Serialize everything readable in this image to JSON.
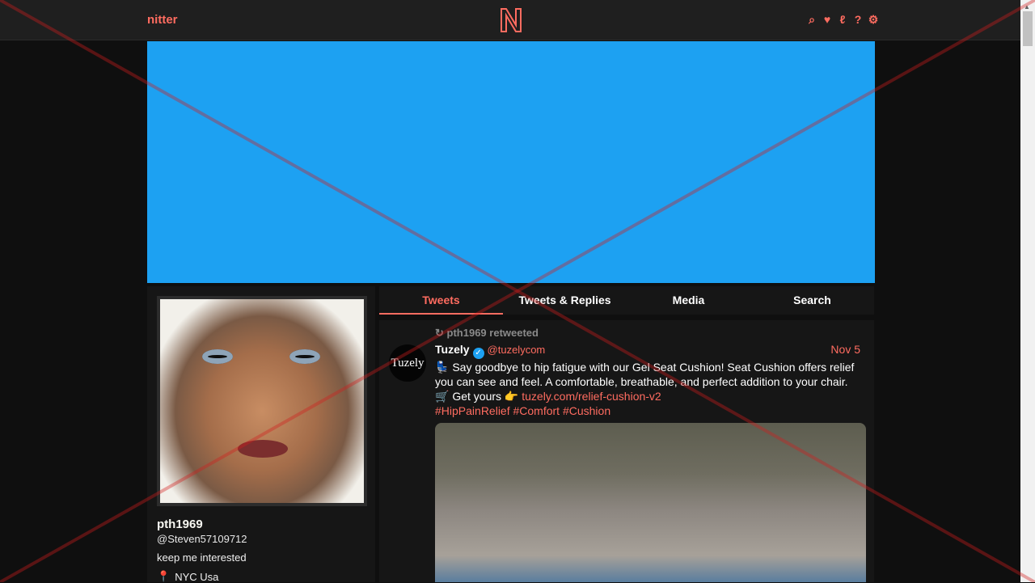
{
  "nav": {
    "brand": "nitter",
    "logo": "N",
    "icons": [
      "search-icon",
      "twitter-icon",
      "lp-icon",
      "help-icon",
      "gear-icon"
    ],
    "accent": "#ff6c60"
  },
  "banner": {
    "color": "#1da1f2"
  },
  "profile": {
    "fullname": "pth1969",
    "username": "@Steven57109712",
    "bio": "keep me interested",
    "location": "NYC Usa"
  },
  "tabs": [
    "Tweets",
    "Tweets & Replies",
    "Media",
    "Search"
  ],
  "tweet": {
    "retweet_text": "pth1969 retweeted",
    "avatar_text": "Tuzely",
    "name": "Tuzely",
    "handle": "@tuzelycom",
    "date": "Nov 5",
    "text_1": "Say goodbye to hip fatigue with our Gel Seat Cushion! Seat Cushion offers relief you can see and feel. A comfortable, breathable, and perfect addition to your chair.",
    "text_2": "Get yours",
    "link": "tuzely.com/relief-cushion-v2",
    "hashtags": "#HipPainRelief #Comfort #Cushion"
  }
}
